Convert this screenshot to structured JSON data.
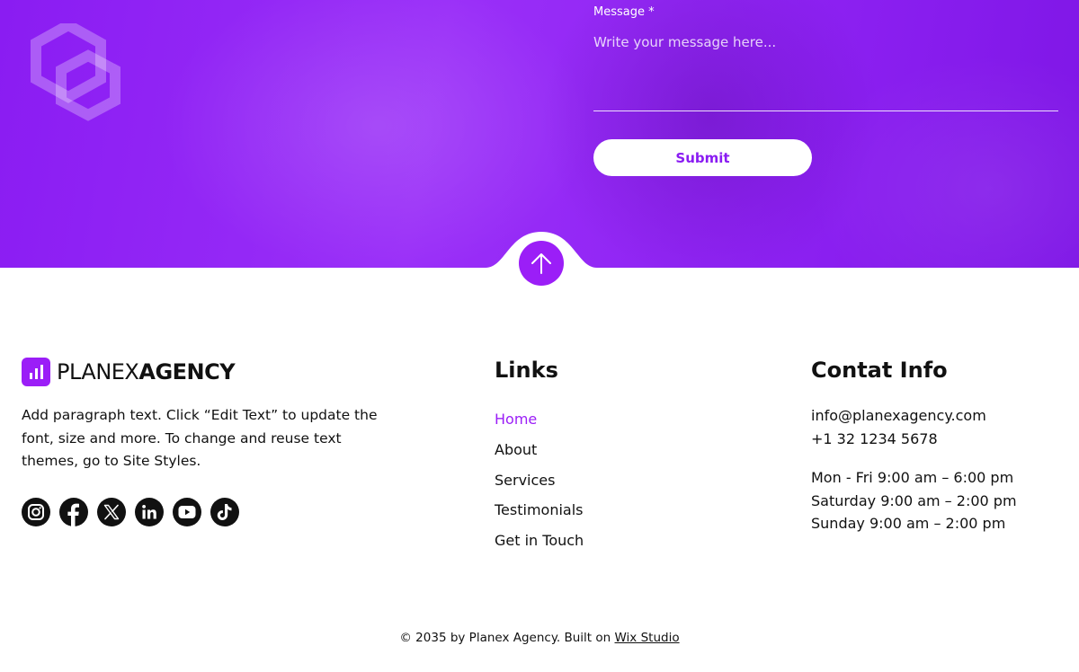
{
  "contact_form": {
    "message_label": "Message *",
    "message_placeholder": "Write your message here...",
    "submit_label": "Submit"
  },
  "colors": {
    "accent": "#9b1ef7",
    "hero": "#8a1cf2"
  },
  "footer": {
    "brand": {
      "light": "PLANEX",
      "bold": "AGENCY"
    },
    "paragraph": "Add paragraph text. Click “Edit Text” to update the font, size and more. To change and reuse text themes, go to Site Styles.",
    "socials": [
      {
        "icon": "instagram-icon"
      },
      {
        "icon": "facebook-icon"
      },
      {
        "icon": "x-icon"
      },
      {
        "icon": "linkedin-icon"
      },
      {
        "icon": "youtube-icon"
      },
      {
        "icon": "tiktok-icon"
      }
    ],
    "links_title": "Links",
    "links": [
      {
        "label": "Home",
        "active": true
      },
      {
        "label": "About"
      },
      {
        "label": "Services"
      },
      {
        "label": "Testimonials"
      },
      {
        "label": "Get in Touch"
      }
    ],
    "contact_title": "Contat Info",
    "email": "info@planexagency.com",
    "phone": "+1 32 1234 5678",
    "hours": [
      "Mon - Fri 9:00 am – 6:00 pm",
      "Saturday 9:00 am – 2:00 pm",
      "Sunday 9:00 am – 2:00 pm"
    ],
    "copyright_text": "© 2035 by Planex Agency. Built on ",
    "copyright_link": "Wix Studio"
  }
}
